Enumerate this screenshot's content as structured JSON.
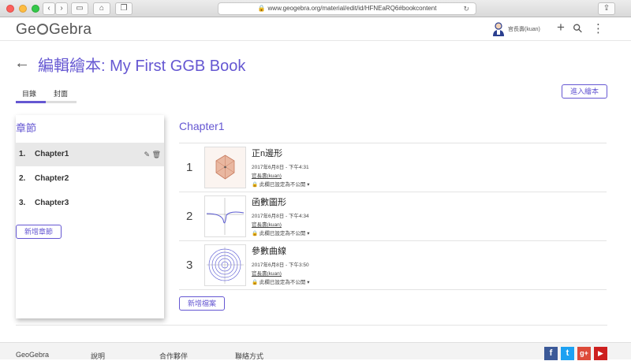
{
  "browser": {
    "url": "www.geogebra.org/material/edit/id/HFNEaRQ6#bookcontent",
    "back_glyph": "‹",
    "forward_glyph": "›",
    "sidebar_glyph": "▭",
    "home_glyph": "⌂",
    "tabs_glyph": "❐",
    "share_glyph": "⇪",
    "lock_glyph": "🔒",
    "reload_glyph": "↻"
  },
  "header": {
    "logo_left": "Ge",
    "logo_right": "Gebra",
    "username": "官長壽(kuan)",
    "plus_glyph": "+",
    "search_glyph": "⚲",
    "menu_glyph": "⋮"
  },
  "page": {
    "back_glyph": "←",
    "title": "編輯繪本: My First GGB Book",
    "tabs": [
      {
        "label": "目錄",
        "active": true
      },
      {
        "label": "封面",
        "active": false
      }
    ],
    "enter_book": "進入繪本"
  },
  "chapters": {
    "heading": "章節",
    "items": [
      {
        "num": "1.",
        "label": "Chapter1",
        "active": true
      },
      {
        "num": "2.",
        "label": "Chapter2",
        "active": false
      },
      {
        "num": "3.",
        "label": "Chapter3",
        "active": false
      }
    ],
    "edit_glyph": "✎",
    "delete_glyph": "🗑",
    "add_chapter": "新增章節"
  },
  "content": {
    "chapter_title": "Chapter1",
    "items": [
      {
        "num": "1",
        "title": "正n邊形",
        "date": "2017年6月8日 - 下午4:31",
        "author": "官長壽(kuan)",
        "privacy": "此欄已設定為不公開 ▾"
      },
      {
        "num": "2",
        "title": "函數圖形",
        "date": "2017年6月8日 - 下午4:34",
        "author": "官長壽(kuan)",
        "privacy": "此欄已設定為不公開 ▾"
      },
      {
        "num": "3",
        "title": "參數曲線",
        "date": "2017年6月8日 - 下午3:50",
        "author": "官長壽(kuan)",
        "privacy": "此欄已設定為不公開 ▾"
      }
    ],
    "lock_glyph": "🔒",
    "add_file": "新增檔案"
  },
  "footer": {
    "links": [
      "GeoGebra",
      "說明",
      "合作夥伴",
      "聯絡方式"
    ],
    "social": [
      {
        "name": "facebook",
        "glyph": "f",
        "color": "#3b5998"
      },
      {
        "name": "twitter",
        "glyph": "t",
        "color": "#1da1f2"
      },
      {
        "name": "google-plus",
        "glyph": "g+",
        "color": "#dd4b39"
      },
      {
        "name": "youtube",
        "glyph": "▶",
        "color": "#cd201f"
      }
    ]
  },
  "colors": {
    "accent": "#6557d2",
    "active_row": "#e8e8e8"
  }
}
